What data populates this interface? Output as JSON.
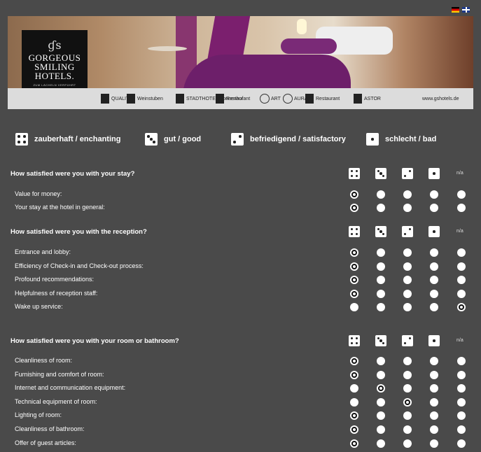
{
  "flags": [
    {
      "name": "german-flag-icon"
    },
    {
      "name": "english-flag-icon"
    }
  ],
  "hotel": {
    "logo_line1": "GORGEOUS",
    "logo_line2": "SMILING",
    "logo_line3": "HOTELS.",
    "logo_sub": "ZUM LÄCHELN VERFÜHRT",
    "partners": [
      "QUALITY",
      "Weinstuben",
      "STADTHOTEL Sonnenhof",
      "Restaurant",
      "ART",
      "AURA",
      "Restaurant",
      "ASTOR",
      "www.gshotels.de"
    ]
  },
  "legend": [
    {
      "score": 4,
      "german": "zauberhaft",
      "english": "enchanting",
      "label": "zauberhaft / enchanting"
    },
    {
      "score": 3,
      "german": "gut",
      "english": "good",
      "label": "gut  / good"
    },
    {
      "score": 2,
      "german": "befriedigend",
      "english": "satisfactory",
      "label": "befriedigend / satisfactory"
    },
    {
      "score": 1,
      "german": "schlecht",
      "english": "bad",
      "label": "schlecht  / bad"
    }
  ],
  "na_label": "n/a",
  "sections": [
    {
      "title": "How satisfied were you with your stay?",
      "questions": [
        {
          "label": "Value for money:",
          "selected": 0
        },
        {
          "label": "Your stay at the hotel in general:",
          "selected": 0
        }
      ]
    },
    {
      "title": "How satisfied were you with the reception?",
      "questions": [
        {
          "label": "Entrance and lobby:",
          "selected": 0
        },
        {
          "label": "Efficiency of Check-in and Check-out process:",
          "selected": 0
        },
        {
          "label": "Profound recommendations:",
          "selected": 0
        },
        {
          "label": "Helpfulness of reception staff:",
          "selected": 0
        },
        {
          "label": "Wake up service:",
          "selected": 4
        }
      ]
    },
    {
      "title": "How satisfied were you with your room or bathroom?",
      "questions": [
        {
          "label": "Cleanliness of room:",
          "selected": 0
        },
        {
          "label": "Furnishing and comfort of room:",
          "selected": 0
        },
        {
          "label": "Internet and communication equipment:",
          "selected": 1
        },
        {
          "label": "Technical equipment of room:",
          "selected": 2
        },
        {
          "label": "Lighting of room:",
          "selected": 0
        },
        {
          "label": "Cleanliness of bathroom:",
          "selected": 0
        },
        {
          "label": "Offer of guest articles:",
          "selected": 0
        }
      ]
    }
  ]
}
